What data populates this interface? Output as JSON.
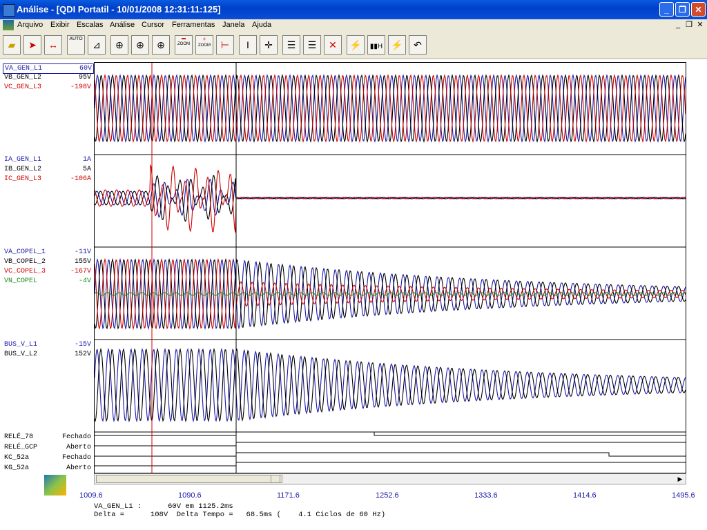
{
  "window": {
    "title": "Análise - [QDI Portatil - 10/01/2008 12:31:11:125]"
  },
  "menu": [
    "Arquivo",
    "Exibir",
    "Escalas",
    "Análise",
    "Cursor",
    "Ferramentas",
    "Janela",
    "Ajuda"
  ],
  "toolbar": {
    "auto_label": "AUTO",
    "zoom_out_label": "ZOOM",
    "zoom_in_label": "ZOOM",
    "harmonic_label": "H"
  },
  "channels": [
    {
      "name": "VA_GEN_L1",
      "value": "60V",
      "color": "#1a1aa8"
    },
    {
      "name": "VB_GEN_L2",
      "value": "95V",
      "color": "#000000"
    },
    {
      "name": "VC_GEN_L3",
      "value": "-198V",
      "color": "#cc0000"
    },
    {
      "name": "IA_GEN_L1",
      "value": "1A",
      "color": "#1a1aa8"
    },
    {
      "name": "IB_GEN_L2",
      "value": "5A",
      "color": "#000000"
    },
    {
      "name": "IC_GEN_L3",
      "value": "-106A",
      "color": "#cc0000"
    },
    {
      "name": "VA_COPEL_1",
      "value": "-11V",
      "color": "#1a1aa8"
    },
    {
      "name": "VB_COPEL_2",
      "value": "155V",
      "color": "#000000"
    },
    {
      "name": "VC_COPEL_3",
      "value": "-167V",
      "color": "#cc0000"
    },
    {
      "name": "VN_COPEL",
      "value": "-4V",
      "color": "#1a8a1a"
    },
    {
      "name": "BUS_V_L1",
      "value": "-15V",
      "color": "#1a1aa8"
    },
    {
      "name": "BUS_V_L2",
      "value": "152V",
      "color": "#000000"
    }
  ],
  "digital": [
    {
      "name": "RELÉ_78",
      "value": "Fechado"
    },
    {
      "name": "RELÉ_GCP",
      "value": "Aberto"
    },
    {
      "name": "KC_52a",
      "value": "Fechado"
    },
    {
      "name": "KG_52a",
      "value": "Aberto"
    }
  ],
  "axis": {
    "ticks": [
      "1009.6",
      "1090.6",
      "1171.6",
      "1252.6",
      "1333.6",
      "1414.6",
      "1495.6"
    ]
  },
  "status": {
    "line1": "VA_GEN_L1 :      60V em 1125.2ms",
    "line2": "Delta =      108V  Delta Tempo =   68.5ms (    4.1 Ciclos de 60 Hz)"
  },
  "colors": {
    "phase_a": "#1a1aa8",
    "phase_b": "#000000",
    "phase_c": "#cc0000",
    "neutral": "#1a8a1a",
    "cursor1": "#cc0000",
    "cursor2": "#000000"
  }
}
